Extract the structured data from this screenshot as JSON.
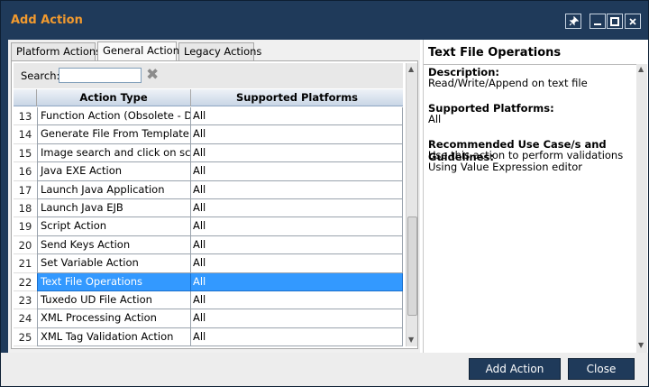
{
  "window": {
    "title": "Add Action"
  },
  "titlebar_buttons": [
    {
      "icon": "pin-icon"
    },
    {
      "icon": "minimize-icon"
    },
    {
      "icon": "maximize-icon"
    },
    {
      "icon": "close-icon"
    }
  ],
  "tabs": [
    {
      "label": "Platform Actions",
      "active": false
    },
    {
      "label": "General Actions",
      "active": true
    },
    {
      "label": "Legacy Actions",
      "active": false
    }
  ],
  "search": {
    "label": "Search:",
    "value": ""
  },
  "grid": {
    "col1": "Action Type",
    "col2": "Supported Platforms",
    "rows": [
      {
        "num": "13",
        "type": "Function Action (Obsolete - Do Not Use)",
        "platforms": "All"
      },
      {
        "num": "14",
        "type": "Generate File From Template Action",
        "platforms": "All"
      },
      {
        "num": "15",
        "type": "Image search and click on screen",
        "platforms": "All"
      },
      {
        "num": "16",
        "type": "Java EXE Action",
        "platforms": "All"
      },
      {
        "num": "17",
        "type": "Launch Java Application",
        "platforms": "All"
      },
      {
        "num": "18",
        "type": "Launch Java EJB",
        "platforms": "All"
      },
      {
        "num": "19",
        "type": "Script Action",
        "platforms": "All"
      },
      {
        "num": "20",
        "type": "Send Keys Action",
        "platforms": "All"
      },
      {
        "num": "21",
        "type": "Set Variable Action",
        "platforms": "All"
      },
      {
        "num": "22",
        "type": "Text File Operations",
        "platforms": "All",
        "selected": true
      },
      {
        "num": "23",
        "type": "Tuxedo UD File Action",
        "platforms": "All"
      },
      {
        "num": "24",
        "type": "XML Processing Action",
        "platforms": "All"
      },
      {
        "num": "25",
        "type": "XML Tag Validation Action",
        "platforms": "All"
      }
    ]
  },
  "details": {
    "title": "Text File Operations",
    "description_label": "Description:",
    "description": "Read/Write/Append on text file",
    "platforms_label": "Supported Platforms:",
    "platforms": "All",
    "guidelines_label": "Recommended Use Case/s and Guidelines:",
    "guidelines": "Use this action to perform validations Using Value Expression editor"
  },
  "buttons": {
    "add": "Add Action",
    "close": "Close"
  },
  "colors": {
    "accent": "#f29a2e",
    "frame": "#1f3a5a",
    "selection": "#3399ff"
  }
}
